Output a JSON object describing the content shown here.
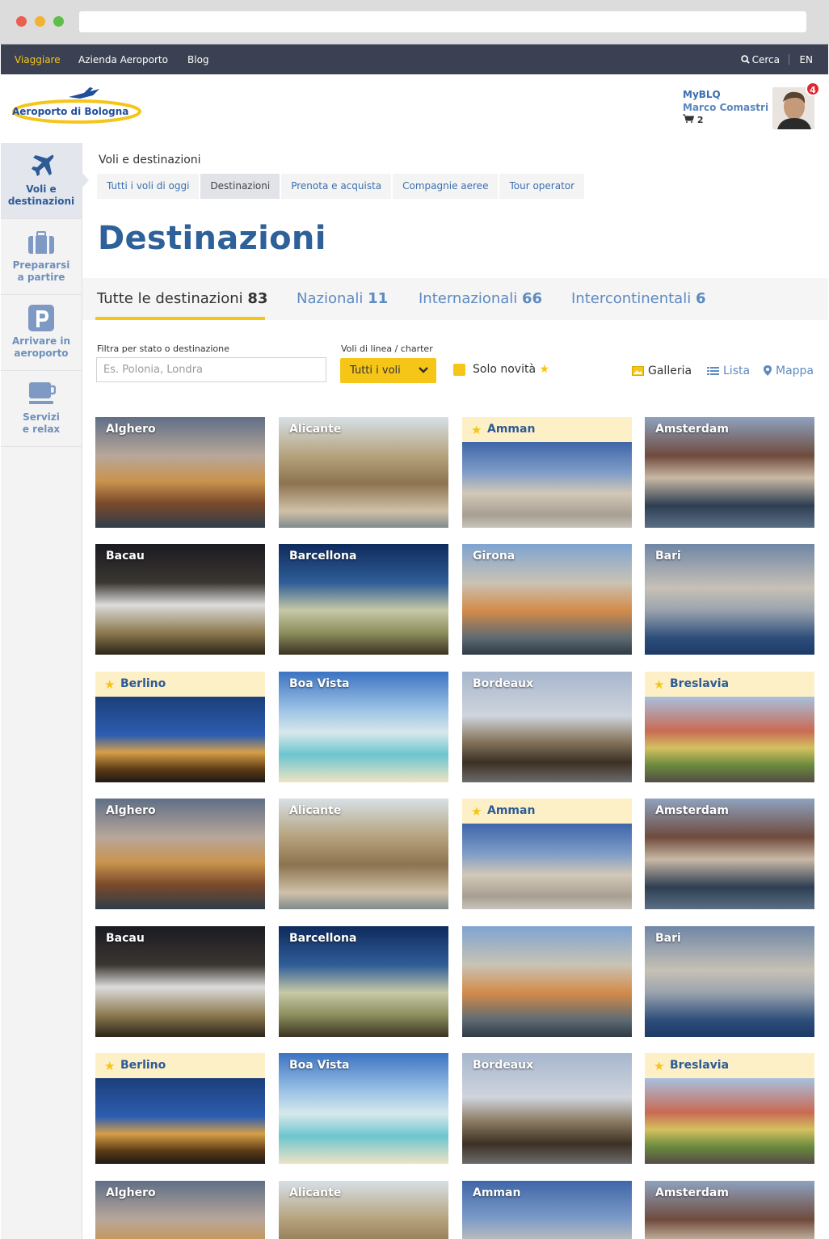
{
  "topnav": {
    "items": [
      "Viaggiare",
      "Azienda Aeroporto",
      "Blog"
    ],
    "search": "Cerca",
    "lang": "EN"
  },
  "header": {
    "logo_text": "Aeroporto di Bologna",
    "logo_mark": "SAB",
    "user": {
      "label": "MyBLQ",
      "name": "Marco Comastri",
      "cart_count": "2",
      "notifications": "4"
    }
  },
  "sidebar": {
    "items": [
      {
        "line1": "Voli e",
        "line2": "destinazioni",
        "icon": "airplane-icon"
      },
      {
        "line1": "Prepararsi",
        "line2": "a partire",
        "icon": "suitcase-icon"
      },
      {
        "line1": "Arrivare in",
        "line2": "aeroporto",
        "icon": "parking-icon"
      },
      {
        "line1": "Servizi",
        "line2": "e relax",
        "icon": "coffee-icon"
      }
    ]
  },
  "breadcrumb": "Voli e destinazioni",
  "subnav": [
    "Tutti i voli di oggi",
    "Destinazioni",
    "Prenota e acquista",
    "Compagnie aeree",
    "Tour operator"
  ],
  "title": "Destinazioni",
  "categories": [
    {
      "label": "Tutte le destinazioni",
      "count": "83"
    },
    {
      "label": "Nazionali",
      "count": "11"
    },
    {
      "label": "Internazionali",
      "count": "66"
    },
    {
      "label": "Intercontinentali",
      "count": "6"
    }
  ],
  "filters": {
    "search_label": "Filtra per stato o destinazione",
    "search_placeholder": "Es. Polonia, Londra",
    "type_label": "Voli di linea / charter",
    "type_value": "Tutti i voli",
    "only_new": "Solo novità"
  },
  "views": [
    "Galleria",
    "Lista",
    "Mappa"
  ],
  "colors": {
    "accent": "#f5c518",
    "nav": "#3b4152",
    "primary": "#2e6099",
    "link": "#5d8ac0"
  },
  "grid": [
    {
      "name": "Alghero",
      "featured": false,
      "tone": "alghero"
    },
    {
      "name": "Alicante",
      "featured": false,
      "tone": "alicante"
    },
    {
      "name": "Amman",
      "featured": true,
      "tone": "amman"
    },
    {
      "name": "Amsterdam",
      "featured": false,
      "tone": "amsterdam"
    },
    {
      "name": "Bacau",
      "featured": false,
      "tone": "bacau"
    },
    {
      "name": "Barcellona",
      "featured": false,
      "tone": "barcellona"
    },
    {
      "name": "Girona",
      "featured": false,
      "tone": "girona"
    },
    {
      "name": "Bari",
      "featured": false,
      "tone": "bari"
    },
    {
      "name": "Berlino",
      "featured": true,
      "tone": "berlino"
    },
    {
      "name": "Boa Vista",
      "featured": false,
      "tone": "boavista"
    },
    {
      "name": "Bordeaux",
      "featured": false,
      "tone": "bordeaux"
    },
    {
      "name": "Breslavia",
      "featured": true,
      "tone": "breslavia"
    },
    {
      "name": "Alghero",
      "featured": false,
      "tone": "alghero"
    },
    {
      "name": "Alicante",
      "featured": false,
      "tone": "alicante"
    },
    {
      "name": "Amman",
      "featured": true,
      "tone": "amman"
    },
    {
      "name": "Amsterdam",
      "featured": false,
      "tone": "amsterdam"
    },
    {
      "name": "Bacau",
      "featured": false,
      "tone": "bacau"
    },
    {
      "name": "Barcellona",
      "featured": false,
      "tone": "barcellona"
    },
    {
      "name": "",
      "featured": false,
      "tone": "girona"
    },
    {
      "name": "Bari",
      "featured": false,
      "tone": "bari"
    },
    {
      "name": "Berlino",
      "featured": true,
      "tone": "berlino"
    },
    {
      "name": "Boa Vista",
      "featured": false,
      "tone": "boavista"
    },
    {
      "name": "Bordeaux",
      "featured": false,
      "tone": "bordeaux"
    },
    {
      "name": "Breslavia",
      "featured": true,
      "tone": "breslavia"
    },
    {
      "name": "Alghero",
      "featured": false,
      "tone": "alghero"
    },
    {
      "name": "Alicante",
      "featured": false,
      "tone": "alicante"
    },
    {
      "name": "Amman",
      "featured": false,
      "tone": "amman"
    },
    {
      "name": "Amsterdam",
      "featured": false,
      "tone": "amsterdam"
    }
  ]
}
